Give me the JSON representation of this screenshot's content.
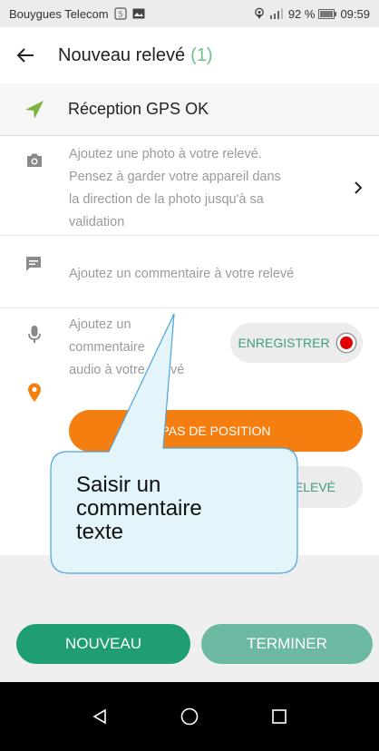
{
  "status_bar": {
    "carrier": "Bouygues Telecom",
    "battery": "92 %",
    "time": "09:59"
  },
  "header": {
    "title": "Nouveau relevé",
    "count": "(1)"
  },
  "gps": {
    "label": "Réception GPS OK",
    "icon": "navigation-arrow-icon",
    "color": "#7cb342"
  },
  "photo": {
    "line1": "Ajoutez une photo à votre relevé.",
    "line2": "Pensez à garder votre appareil dans",
    "line3": "la direction de la photo jusqu'à sa",
    "line4": "validation"
  },
  "comment": {
    "text": "Ajoutez un commentaire à votre relevé"
  },
  "audio": {
    "line1": "Ajoutez un",
    "line2": "commentaire",
    "line3": "audio à votre relevé",
    "record_label": "ENREGISTRER"
  },
  "position": {
    "button_label": "PAS DE POSITION",
    "view_label": "ELEVÉ"
  },
  "actions": {
    "new_label": "NOUVEAU",
    "finish_label": "TERMINER"
  },
  "callout": {
    "line1": "Saisir un",
    "line2": "commentaire",
    "line3": "texte"
  },
  "colors": {
    "green_primary": "#1f9e74",
    "green_light": "#6cb8a2",
    "orange": "#f47e10",
    "accent_text": "#3e9e7c",
    "callout_fill": "#e3f4fb",
    "callout_stroke": "#4aa3df"
  }
}
